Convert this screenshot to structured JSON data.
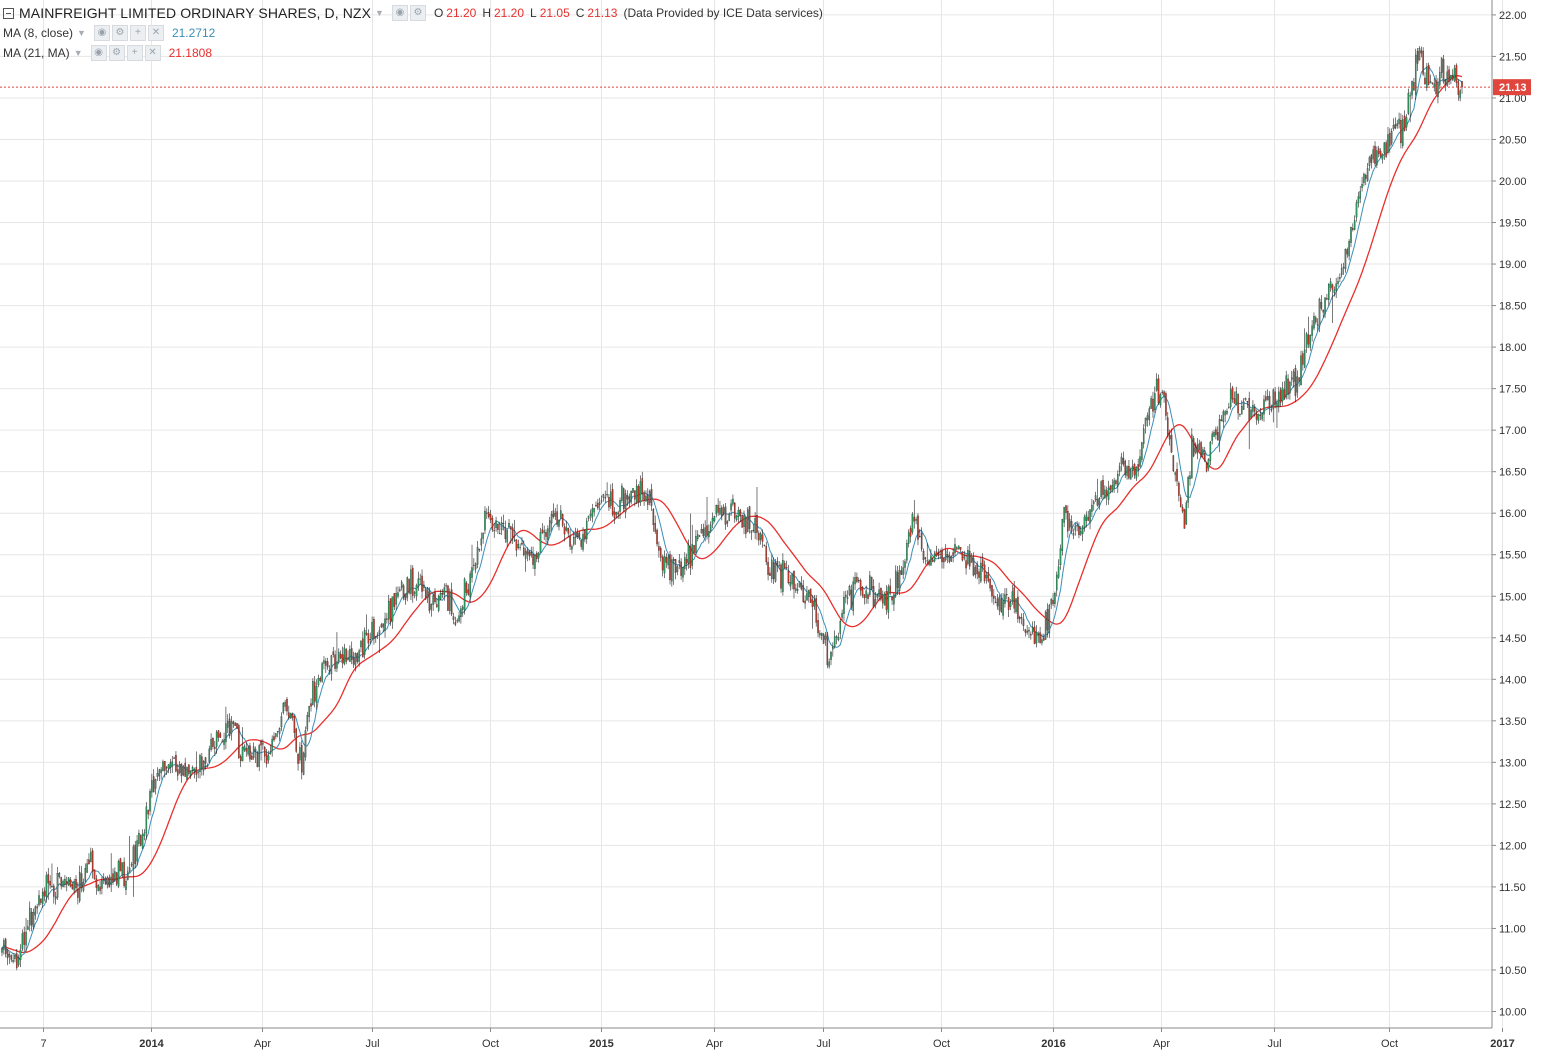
{
  "header": {
    "symbol_title": "MAINFREIGHT LIMITED ORDINARY SHARES, D, NZX",
    "ohlc": {
      "o_label": "O",
      "o_value": "21.20",
      "h_label": "H",
      "h_value": "21.20",
      "l_label": "L",
      "l_value": "21.05",
      "c_label": "C",
      "c_value": "21.13"
    },
    "data_note": "(Data Provided by ICE Data services)"
  },
  "indicators": [
    {
      "label": "MA (8, close)",
      "value": "21.2712",
      "color": "#3a8fb7"
    },
    {
      "label": "MA (21, MA)",
      "value": "21.1808",
      "color": "#e8302c"
    }
  ],
  "price_tag": {
    "value": "21.13",
    "color": "#e0463e"
  },
  "colors": {
    "up": "#2e9c62",
    "down": "#c0392b",
    "wick": "#222222",
    "grid": "#e6e6e6"
  },
  "chart_data": {
    "type": "candlestick",
    "title": "MAINFREIGHT LIMITED ORDINARY SHARES, D, NZX",
    "y_ticks": [
      "22.00",
      "21.50",
      "21.00",
      "20.50",
      "20.00",
      "19.50",
      "19.00",
      "18.50",
      "18.00",
      "17.50",
      "17.00",
      "16.50",
      "16.00",
      "15.50",
      "15.00",
      "14.50",
      "14.00",
      "13.50",
      "13.00",
      "12.50",
      "12.00",
      "11.50",
      "11.00",
      "10.50",
      "10.00"
    ],
    "ylim": [
      9.85,
      22.1
    ],
    "x_ticks": [
      {
        "label": "7",
        "bold": false
      },
      {
        "label": "2014",
        "bold": true
      },
      {
        "label": "Apr",
        "bold": false
      },
      {
        "label": "Jul",
        "bold": false
      },
      {
        "label": "Oct",
        "bold": false
      },
      {
        "label": "2015",
        "bold": true
      },
      {
        "label": "Apr",
        "bold": false
      },
      {
        "label": "Jul",
        "bold": false
      },
      {
        "label": "Oct",
        "bold": false
      },
      {
        "label": "2016",
        "bold": true
      },
      {
        "label": "Apr",
        "bold": false
      },
      {
        "label": "Jul",
        "bold": false
      },
      {
        "label": "Oct",
        "bold": false
      },
      {
        "label": "2017",
        "bold": true
      }
    ],
    "x_tick_pos": [
      0.028,
      0.098,
      0.17,
      0.241,
      0.318,
      0.39,
      0.463,
      0.534,
      0.61,
      0.683,
      0.753,
      0.826,
      0.901,
      0.974
    ],
    "price_path": [
      [
        0.0,
        10.75
      ],
      [
        0.012,
        10.65
      ],
      [
        0.02,
        11.2
      ],
      [
        0.03,
        11.45
      ],
      [
        0.04,
        11.55
      ],
      [
        0.05,
        11.4
      ],
      [
        0.06,
        11.8
      ],
      [
        0.07,
        11.55
      ],
      [
        0.08,
        11.65
      ],
      [
        0.09,
        11.7
      ],
      [
        0.098,
        12.1
      ],
      [
        0.11,
        13.0
      ],
      [
        0.12,
        12.9
      ],
      [
        0.13,
        12.85
      ],
      [
        0.14,
        13.0
      ],
      [
        0.15,
        13.2
      ],
      [
        0.16,
        13.5
      ],
      [
        0.17,
        13.05
      ],
      [
        0.18,
        13.1
      ],
      [
        0.19,
        13.15
      ],
      [
        0.2,
        13.7
      ],
      [
        0.21,
        12.95
      ],
      [
        0.215,
        13.7
      ],
      [
        0.225,
        14.2
      ],
      [
        0.24,
        14.3
      ],
      [
        0.25,
        14.35
      ],
      [
        0.26,
        14.6
      ],
      [
        0.275,
        14.9
      ],
      [
        0.29,
        15.2
      ],
      [
        0.3,
        14.95
      ],
      [
        0.31,
        15.05
      ],
      [
        0.32,
        14.8
      ],
      [
        0.33,
        15.3
      ],
      [
        0.34,
        15.95
      ],
      [
        0.35,
        15.8
      ],
      [
        0.36,
        15.7
      ],
      [
        0.37,
        15.35
      ],
      [
        0.38,
        15.7
      ],
      [
        0.39,
        16.05
      ],
      [
        0.4,
        15.6
      ],
      [
        0.41,
        15.8
      ],
      [
        0.42,
        16.2
      ],
      [
        0.43,
        16.1
      ],
      [
        0.445,
        16.25
      ],
      [
        0.455,
        16.2
      ],
      [
        0.462,
        15.5
      ],
      [
        0.47,
        15.3
      ],
      [
        0.48,
        15.4
      ],
      [
        0.49,
        15.7
      ],
      [
        0.5,
        16.0
      ],
      [
        0.51,
        16.05
      ],
      [
        0.52,
        15.95
      ],
      [
        0.53,
        15.8
      ],
      [
        0.54,
        15.3
      ],
      [
        0.55,
        15.25
      ],
      [
        0.56,
        15.1
      ],
      [
        0.57,
        14.9
      ],
      [
        0.58,
        14.2
      ],
      [
        0.585,
        14.35
      ],
      [
        0.59,
        14.9
      ],
      [
        0.6,
        15.15
      ],
      [
        0.61,
        15.1
      ],
      [
        0.62,
        14.9
      ],
      [
        0.63,
        15.25
      ],
      [
        0.64,
        15.95
      ],
      [
        0.65,
        15.3
      ],
      [
        0.66,
        15.5
      ],
      [
        0.67,
        15.55
      ],
      [
        0.68,
        15.45
      ],
      [
        0.69,
        15.2
      ],
      [
        0.7,
        14.95
      ],
      [
        0.71,
        15.0
      ],
      [
        0.72,
        14.6
      ],
      [
        0.73,
        14.5
      ],
      [
        0.74,
        15.05
      ],
      [
        0.745,
        16.0
      ],
      [
        0.755,
        15.75
      ],
      [
        0.765,
        16.1
      ],
      [
        0.775,
        16.3
      ],
      [
        0.785,
        16.6
      ],
      [
        0.795,
        16.4
      ],
      [
        0.8,
        16.9
      ],
      [
        0.81,
        17.45
      ],
      [
        0.815,
        17.5
      ],
      [
        0.82,
        16.7
      ],
      [
        0.825,
        16.4
      ],
      [
        0.83,
        15.8
      ],
      [
        0.835,
        16.8
      ],
      [
        0.845,
        16.6
      ],
      [
        0.85,
        16.9
      ],
      [
        0.86,
        17.3
      ],
      [
        0.87,
        17.3
      ],
      [
        0.88,
        17.2
      ],
      [
        0.89,
        17.35
      ],
      [
        0.9,
        17.5
      ],
      [
        0.91,
        17.6
      ],
      [
        0.915,
        18.1
      ],
      [
        0.925,
        18.5
      ],
      [
        0.93,
        18.6
      ],
      [
        0.94,
        19.0
      ],
      [
        0.945,
        19.1
      ],
      [
        0.95,
        19.6
      ],
      [
        0.955,
        20.0
      ],
      [
        0.965,
        20.4
      ],
      [
        0.975,
        20.5
      ],
      [
        0.985,
        20.7
      ],
      [
        0.99,
        21.2
      ],
      [
        0.995,
        21.5
      ],
      [
        1.0,
        21.3
      ],
      [
        1.005,
        21.05
      ],
      [
        1.01,
        21.3
      ],
      [
        1.02,
        21.2
      ],
      [
        1.025,
        21.13
      ]
    ],
    "series": [
      {
        "name": "MA (8, close)"
      },
      {
        "name": "MA (21, MA)"
      }
    ],
    "last_close": 21.13,
    "grid": true
  }
}
